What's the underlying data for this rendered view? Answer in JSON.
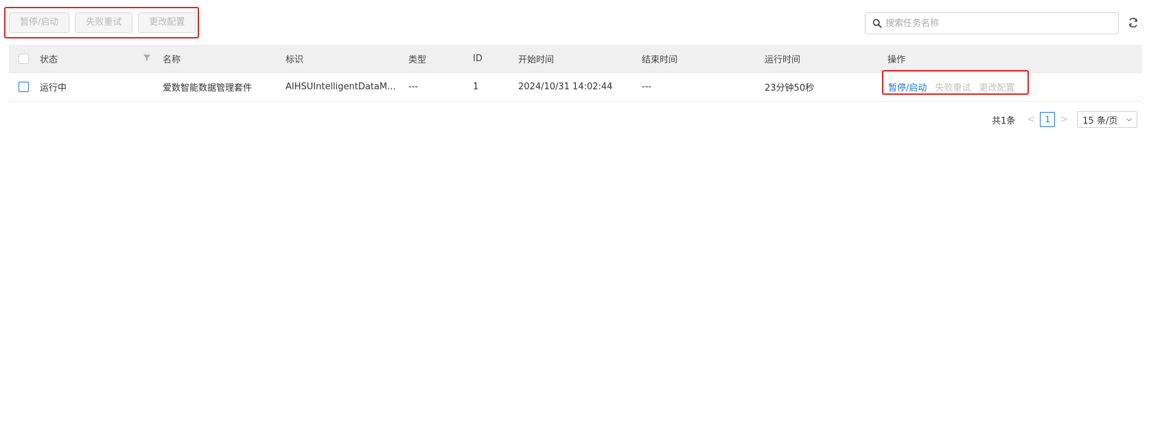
{
  "toolbar": {
    "pause_start": "暂停/启动",
    "retry_failed": "失败重试",
    "change_config": "更改配置"
  },
  "search": {
    "placeholder": "搜索任务名称",
    "value": ""
  },
  "table": {
    "columns": {
      "status": "状态",
      "name": "名称",
      "identifier": "标识",
      "type": "类型",
      "id": "ID",
      "start_time": "开始时间",
      "end_time": "结束时间",
      "run_time": "运行时间",
      "actions": "操作"
    },
    "rows": [
      {
        "status": "运行中",
        "name": "爱数智能数据管理套件",
        "identifier": "AIHSUIntelligentDataM...",
        "type": "---",
        "id": "1",
        "start_time": "2024/10/31 14:02:44",
        "end_time": "---",
        "run_time": "23分钟50秒",
        "actions": {
          "pause_start": "暂停/启动",
          "retry_failed": "失败重试",
          "change_config": "更改配置"
        }
      }
    ]
  },
  "pagination": {
    "total": "共1条",
    "current_page": "1",
    "page_size": "15 条/页",
    "prev": "<",
    "next": ">"
  },
  "colors": {
    "accent": "#1a73e8",
    "highlight": "#e5211e",
    "disabled_text": "#c0c0c0",
    "header_bg": "#f0f0f0"
  },
  "icons": {
    "search": "search-icon",
    "refresh": "refresh-icon",
    "filter": "filter-icon",
    "chevron": "chevron-down-icon"
  }
}
